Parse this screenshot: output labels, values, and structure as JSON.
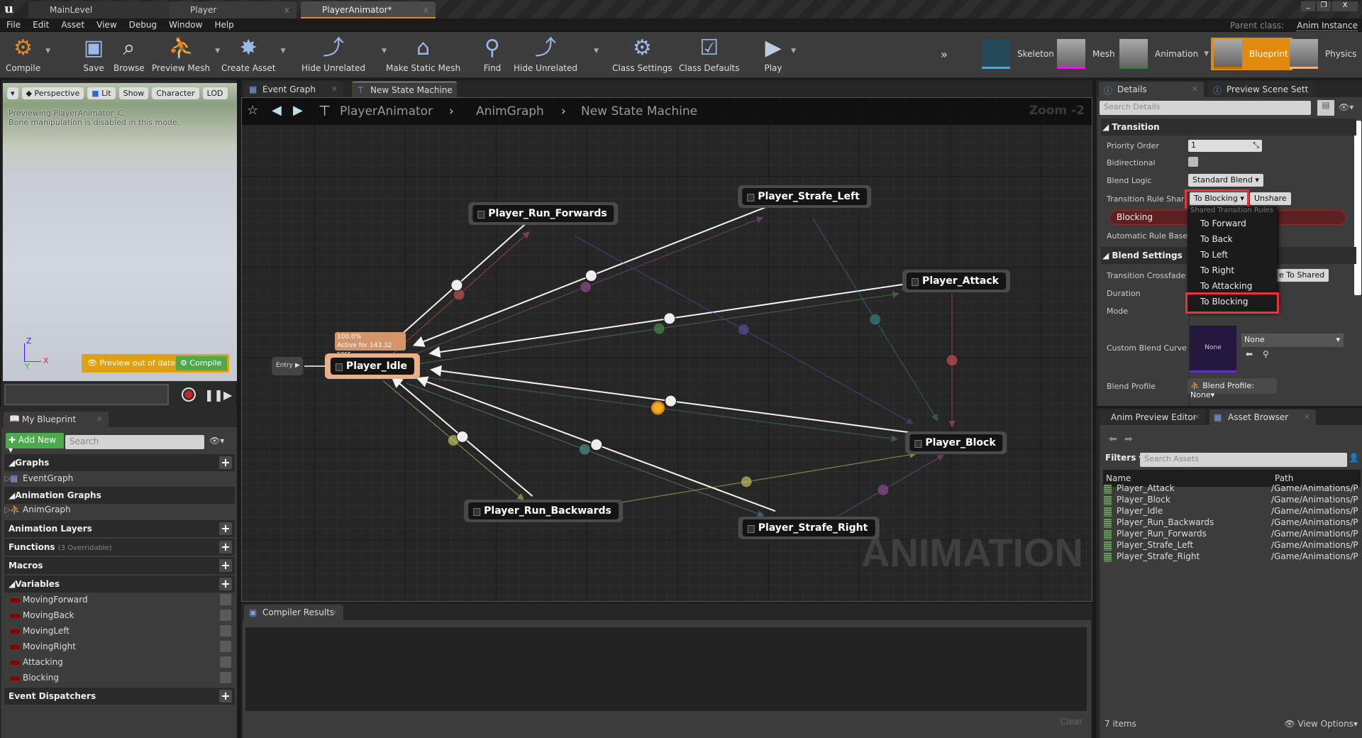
{
  "window": {
    "tabs": [
      {
        "label": "MainLevel"
      },
      {
        "label": "Player"
      },
      {
        "label": "PlayerAnimator*"
      }
    ],
    "close_glyph": "x",
    "controls": {
      "minimize": "_",
      "restore": "❐",
      "close": "X"
    }
  },
  "menu": [
    "File",
    "Edit",
    "Asset",
    "View",
    "Debug",
    "Window",
    "Help"
  ],
  "parent_class": {
    "label": "Parent class:",
    "value": "Anim Instance"
  },
  "toolbar": {
    "buttons": [
      {
        "label": "Compile",
        "icon": "compile-icon"
      },
      {
        "label": "Save",
        "icon": "save-icon"
      },
      {
        "label": "Browse",
        "icon": "browse-icon"
      },
      {
        "label": "Preview Mesh",
        "icon": "preview-mesh-icon"
      },
      {
        "label": "Create Asset",
        "icon": "create-asset-icon"
      },
      {
        "label": "Hide Unrelated",
        "icon": "hide-unrelated-icon"
      },
      {
        "label": "Make Static Mesh",
        "icon": "make-static-mesh-icon"
      },
      {
        "label": "Find",
        "icon": "find-icon"
      },
      {
        "label": "Hide Unrelated",
        "icon": "hide-unrelated-icon"
      },
      {
        "label": "Class Settings",
        "icon": "class-settings-icon"
      },
      {
        "label": "Class Defaults",
        "icon": "class-defaults-icon"
      },
      {
        "label": "Play",
        "icon": "play-icon"
      }
    ],
    "modes": [
      {
        "label": "Skeleton",
        "accent": "#5aa6c8"
      },
      {
        "label": "Mesh",
        "accent": "#e020e0"
      },
      {
        "label": "Animation",
        "accent": "#3a7a3a"
      },
      {
        "label": "Blueprint",
        "accent": "#e08a10",
        "active": true
      },
      {
        "label": "Physics",
        "accent": "#f0b080"
      }
    ]
  },
  "viewport": {
    "buttons": [
      "Perspective",
      "Lit",
      "Show",
      "Character",
      "LOD"
    ],
    "info_line1": "Previewing PlayerAnimator_C.",
    "info_line2": "Bone manipulation is disabled in this mode.",
    "axis": {
      "z": "Z",
      "x": "X",
      "y": "Y"
    },
    "preview_status": "Preview out of date",
    "compile_label": "Compile"
  },
  "my_blueprint": {
    "tab": "My Blueprint",
    "add_new": "Add New",
    "search_placeholder": "Search",
    "graphs_header": "Graphs",
    "event_graph": "EventGraph",
    "anim_graphs_header": "Animation Graphs",
    "anim_graph": "AnimGraph",
    "anim_layers": "Animation Layers",
    "functions": "Functions",
    "functions_note": "(3 Overridable)",
    "macros": "Macros",
    "variables_header": "Variables",
    "variables": [
      "MovingForward",
      "MovingBack",
      "MovingLeft",
      "MovingRight",
      "Attacking",
      "Blocking"
    ],
    "event_dispatchers": "Event Dispatchers"
  },
  "graph": {
    "tabs": [
      {
        "label": "Event Graph"
      },
      {
        "label": "New State Machine"
      }
    ],
    "breadcrumb": [
      "PlayerAnimator",
      "AnimGraph",
      "New State Machine"
    ],
    "zoom": "Zoom -2",
    "watermark": "ANIMATION",
    "entry": "Entry",
    "idle_tooltip": {
      "percent": "100.0%",
      "active": "Active for 143.32 secs"
    },
    "states": [
      {
        "id": "Player_Idle",
        "label": "Player_Idle",
        "active": true
      },
      {
        "id": "Player_Run_Forwards",
        "label": "Player_Run_Forwards"
      },
      {
        "id": "Player_Strafe_Left",
        "label": "Player_Strafe_Left"
      },
      {
        "id": "Player_Attack",
        "label": "Player_Attack"
      },
      {
        "id": "Player_Block",
        "label": "Player_Block"
      },
      {
        "id": "Player_Run_Backwards",
        "label": "Player_Run_Backwards"
      },
      {
        "id": "Player_Strafe_Right",
        "label": "Player_Strafe_Right"
      }
    ],
    "transitions": [
      [
        "Player_Idle",
        "Player_Run_Forwards"
      ],
      [
        "Player_Run_Forwards",
        "Player_Idle"
      ],
      [
        "Player_Idle",
        "Player_Strafe_Left"
      ],
      [
        "Player_Strafe_Left",
        "Player_Idle"
      ],
      [
        "Player_Idle",
        "Player_Attack"
      ],
      [
        "Player_Attack",
        "Player_Idle"
      ],
      [
        "Player_Idle",
        "Player_Block"
      ],
      [
        "Player_Block",
        "Player_Idle"
      ],
      [
        "Player_Idle",
        "Player_Run_Backwards"
      ],
      [
        "Player_Run_Backwards",
        "Player_Idle"
      ],
      [
        "Player_Idle",
        "Player_Strafe_Right"
      ],
      [
        "Player_Strafe_Right",
        "Player_Idle"
      ],
      [
        "Player_Run_Forwards",
        "Player_Block"
      ],
      [
        "Player_Strafe_Left",
        "Player_Block"
      ],
      [
        "Player_Attack",
        "Player_Block"
      ],
      [
        "Player_Run_Backwards",
        "Player_Block"
      ],
      [
        "Player_Strafe_Right",
        "Player_Block"
      ]
    ]
  },
  "compiler": {
    "tab": "Compiler Results",
    "clear": "Clear"
  },
  "details": {
    "tabs": [
      "Details",
      "Preview Scene Sett"
    ],
    "search_placeholder": "Search Details",
    "transition_header": "Transition",
    "priority_order": {
      "label": "Priority Order",
      "value": "1"
    },
    "bidirectional": {
      "label": "Bidirectional",
      "checked": false
    },
    "blend_logic": {
      "label": "Blend Logic",
      "value": "Standard Blend"
    },
    "rule_sharing": {
      "label": "Transition Rule Shari",
      "value": "To Blocking",
      "unshare": "Unshare"
    },
    "rule_variable": "Blocking",
    "automatic_rule": "Automatic Rule Basec",
    "blend_header": "Blend Settings",
    "crossfade": {
      "label": "Transition Crossfade",
      "button": "e To Shared"
    },
    "duration": "Duration",
    "mode": "Mode",
    "custom_curve": {
      "label": "Custom Blend Curve",
      "thumb": "None",
      "value": "None"
    },
    "blend_profile": {
      "label": "Blend Profile",
      "value": "Blend Profile: None"
    },
    "dropdown": {
      "header": "Shared Transition Rules",
      "items": [
        "To Forward",
        "To Back",
        "To Left",
        "To Right",
        "To Attacking",
        "To Blocking"
      ],
      "selected": "To Blocking"
    },
    "highlight_color": "#e8343a"
  },
  "assets": {
    "tabs": [
      "Anim Preview Editor",
      "Asset Browser"
    ],
    "filters": "Filters",
    "search_placeholder": "Search Assets",
    "columns": [
      "Name",
      "Path"
    ],
    "rows": [
      {
        "name": "Player_Attack",
        "path": "/Game/Animations/P"
      },
      {
        "name": "Player_Block",
        "path": "/Game/Animations/P"
      },
      {
        "name": "Player_Idle",
        "path": "/Game/Animations/P"
      },
      {
        "name": "Player_Run_Backwards",
        "path": "/Game/Animations/P"
      },
      {
        "name": "Player_Run_Forwards",
        "path": "/Game/Animations/P"
      },
      {
        "name": "Player_Strafe_Left",
        "path": "/Game/Animations/P"
      },
      {
        "name": "Player_Strafe_Right",
        "path": "/Game/Animations/P"
      }
    ],
    "count": "7 items",
    "view_options": "View Options"
  }
}
